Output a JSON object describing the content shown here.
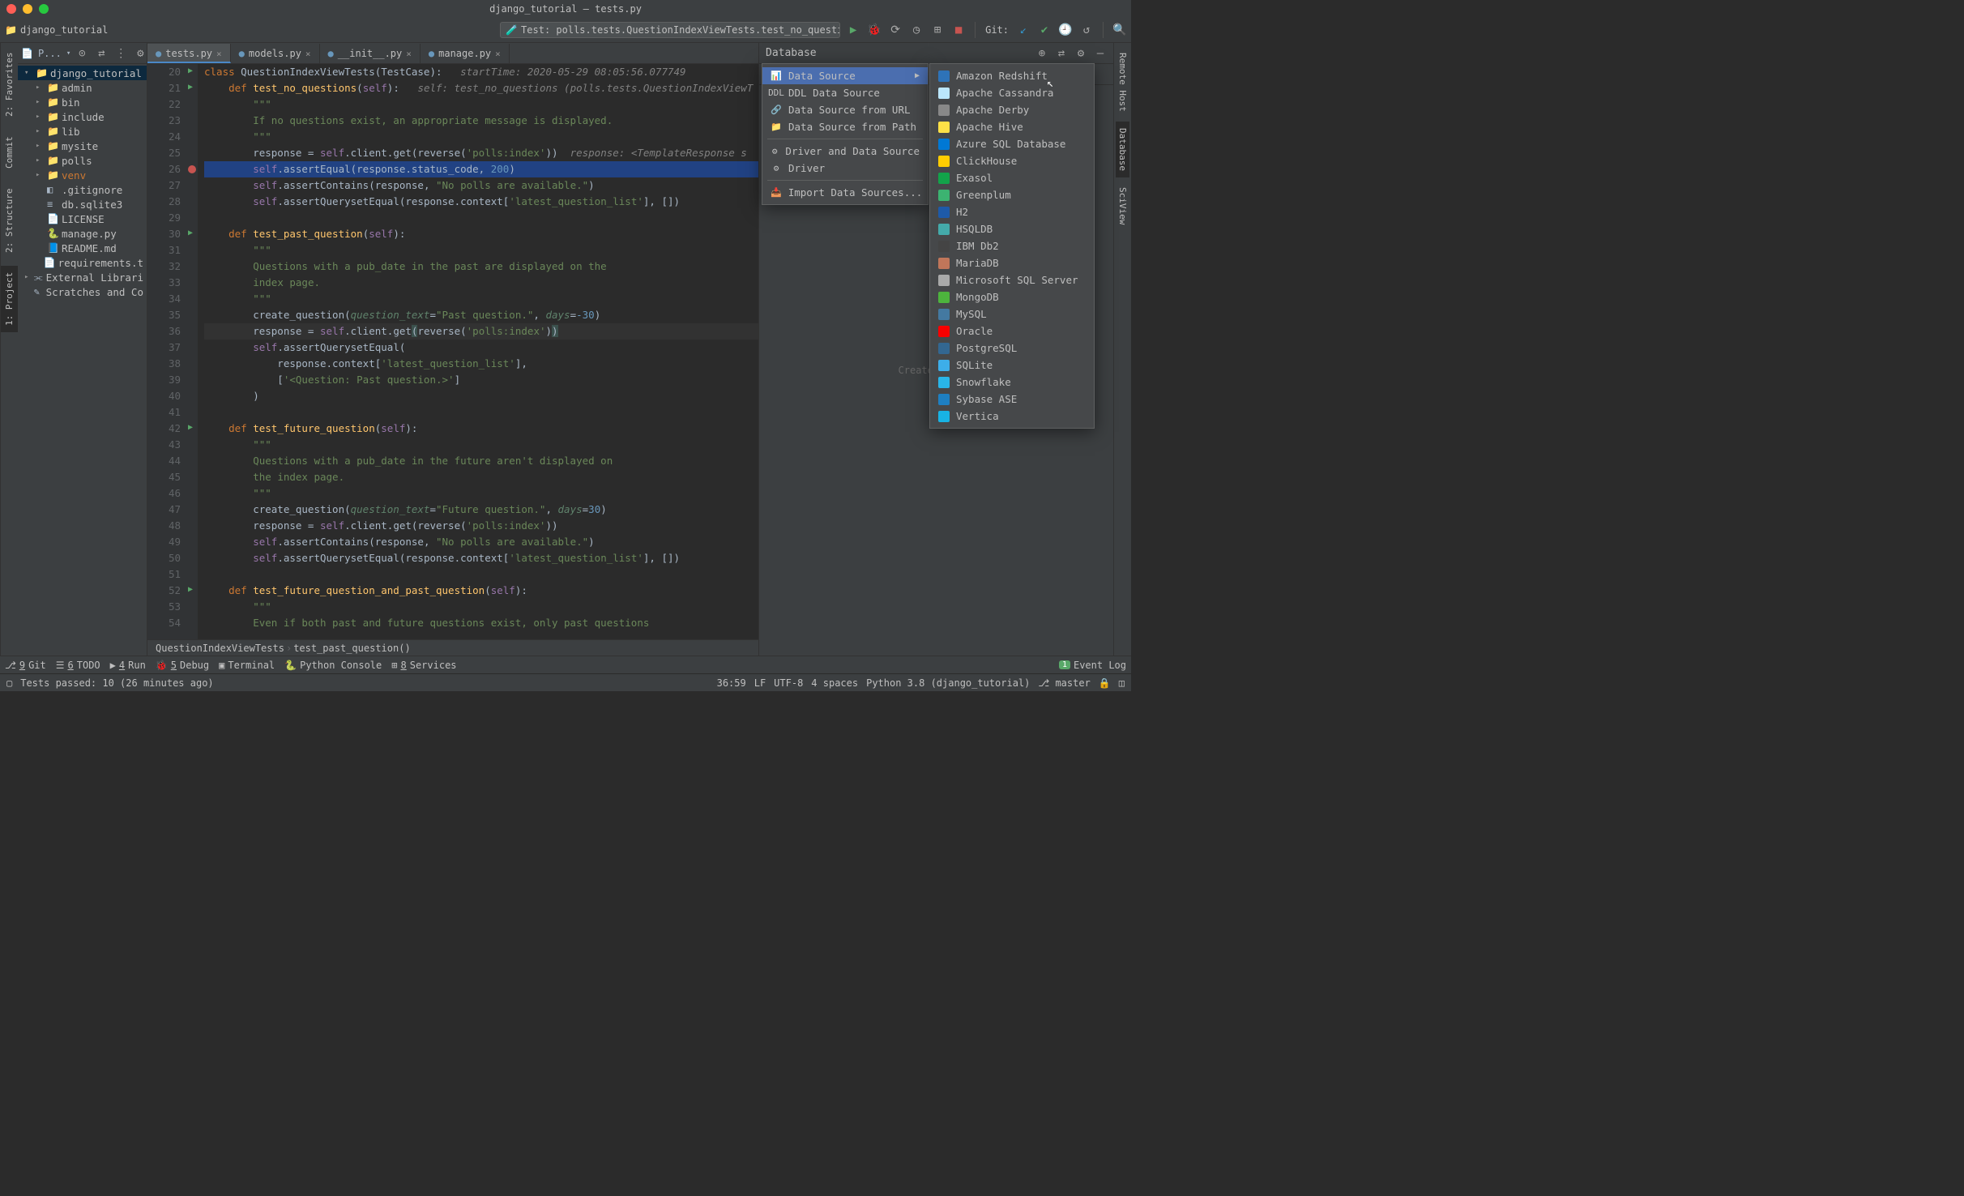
{
  "title": "django_tutorial – tests.py",
  "breadcrumb": "django_tutorial",
  "runConfig": "Test: polls.tests.QuestionIndexViewTests.test_no_questions",
  "gitLabel": "Git:",
  "leftTabs": [
    "1: Project",
    "2: Structure",
    "Commit",
    "2: Favorites"
  ],
  "rightTabs": [
    "Remote Host",
    "Database",
    "SciView"
  ],
  "sidebar": {
    "header": "P...",
    "tree": [
      {
        "lvl": 0,
        "arrow": "▾",
        "ico": "📁",
        "name": "django_tutorial",
        "root": true
      },
      {
        "lvl": 1,
        "arrow": "▸",
        "ico": "📁",
        "name": "admin"
      },
      {
        "lvl": 1,
        "arrow": "▸",
        "ico": "📁",
        "name": "bin"
      },
      {
        "lvl": 1,
        "arrow": "▸",
        "ico": "📁",
        "name": "include"
      },
      {
        "lvl": 1,
        "arrow": "▸",
        "ico": "📁",
        "name": "lib"
      },
      {
        "lvl": 1,
        "arrow": "▸",
        "ico": "📁",
        "name": "mysite"
      },
      {
        "lvl": 1,
        "arrow": "▸",
        "ico": "📁",
        "name": "polls"
      },
      {
        "lvl": 1,
        "arrow": "▸",
        "ico": "📁",
        "name": "venv",
        "venv": true
      },
      {
        "lvl": 1,
        "arrow": "",
        "ico": "◧",
        "name": ".gitignore"
      },
      {
        "lvl": 1,
        "arrow": "",
        "ico": "≡",
        "name": "db.sqlite3"
      },
      {
        "lvl": 1,
        "arrow": "",
        "ico": "📄",
        "name": "LICENSE"
      },
      {
        "lvl": 1,
        "arrow": "",
        "ico": "🐍",
        "name": "manage.py"
      },
      {
        "lvl": 1,
        "arrow": "",
        "ico": "📘",
        "name": "README.md"
      },
      {
        "lvl": 1,
        "arrow": "",
        "ico": "📄",
        "name": "requirements.t"
      },
      {
        "lvl": 0,
        "arrow": "▸",
        "ico": "⫘",
        "name": "External Librari"
      },
      {
        "lvl": 0,
        "arrow": "",
        "ico": "✎",
        "name": "Scratches and Co"
      }
    ]
  },
  "editorTabs": [
    {
      "label": "tests.py",
      "active": true
    },
    {
      "label": "models.py"
    },
    {
      "label": "__init__.py"
    },
    {
      "label": "manage.py"
    }
  ],
  "codeLines": [
    {
      "n": 20,
      "mark": "run",
      "html": "<span class='k'>class </span><span class='p'>QuestionIndexViewTests(TestCase):   </span><span class='c'>startTime: 2020-05-29 08:05:56.077749</span>"
    },
    {
      "n": 21,
      "mark": "run",
      "html": "    <span class='k'>def </span><span class='fn'>test_no_questions</span>(<span class='self'>self</span>):   <span class='c'>self: test_no_questions (polls.tests.QuestionIndexViewT</span>"
    },
    {
      "n": 22,
      "html": "        <span class='s'>\"\"\"</span>"
    },
    {
      "n": 23,
      "html": "        <span class='s'>If no questions exist, an appropriate message is displayed.</span>"
    },
    {
      "n": 24,
      "html": "        <span class='s'>\"\"\"</span>"
    },
    {
      "n": 25,
      "html": "        response = <span class='self'>self</span>.client.get(reverse(<span class='s'>'polls:index'</span>))  <span class='c'>response: &lt;TemplateResponse s</span>"
    },
    {
      "n": 26,
      "mark": "bp",
      "hl": true,
      "html": "        <span class='self'>self</span>.assertEqual(response.status_code, <span class='num'>200</span>)"
    },
    {
      "n": 27,
      "html": "        <span class='self'>self</span>.assertContains(response, <span class='s'>\"No polls are available.\"</span>)"
    },
    {
      "n": 28,
      "html": "        <span class='self'>self</span>.assertQuerysetEqual(response.context[<span class='s'>'latest_question_list'</span>], [])"
    },
    {
      "n": 29,
      "html": ""
    },
    {
      "n": 30,
      "mark": "run",
      "html": "    <span class='k'>def </span><span class='fn'>test_past_question</span>(<span class='self'>self</span>):"
    },
    {
      "n": 31,
      "html": "        <span class='s'>\"\"\"</span>"
    },
    {
      "n": 32,
      "html": "        <span class='s'>Questions with a pub_date in the past are displayed on the</span>"
    },
    {
      "n": 33,
      "html": "        <span class='s'>index page.</span>"
    },
    {
      "n": 34,
      "html": "        <span class='s'>\"\"\"</span>"
    },
    {
      "n": 35,
      "html": "        create_question(<span class='hint'>question_text</span>=<span class='s'>\"Past question.\"</span>, <span class='hint'>days</span>=<span class='num'>-30</span>)"
    },
    {
      "n": 36,
      "caret": true,
      "html": "        response = <span class='self'>self</span>.client.get<span style='background:#3b514d'>(</span>reverse(<span class='s'>'polls:index'</span>)<span style='background:#3b514d'>)</span>"
    },
    {
      "n": 37,
      "html": "        <span class='self'>self</span>.assertQuerysetEqual("
    },
    {
      "n": 38,
      "html": "            response.context[<span class='s'>'latest_question_list'</span>],"
    },
    {
      "n": 39,
      "html": "            [<span class='s'>'&lt;Question: Past question.&gt;'</span>]"
    },
    {
      "n": 40,
      "html": "        )"
    },
    {
      "n": 41,
      "html": ""
    },
    {
      "n": 42,
      "mark": "run",
      "html": "    <span class='k'>def </span><span class='fn'>test_future_question</span>(<span class='self'>self</span>):"
    },
    {
      "n": 43,
      "html": "        <span class='s'>\"\"\"</span>"
    },
    {
      "n": 44,
      "html": "        <span class='s'>Questions with a pub_date in the future aren't displayed on</span>"
    },
    {
      "n": 45,
      "html": "        <span class='s'>the index page.</span>"
    },
    {
      "n": 46,
      "html": "        <span class='s'>\"\"\"</span>"
    },
    {
      "n": 47,
      "html": "        create_question(<span class='hint'>question_text</span>=<span class='s'>\"Future question.\"</span>, <span class='hint'>days</span>=<span class='num'>30</span>)"
    },
    {
      "n": 48,
      "html": "        response = <span class='self'>self</span>.client.get(reverse(<span class='s'>'polls:index'</span>))"
    },
    {
      "n": 49,
      "html": "        <span class='self'>self</span>.assertContains(response, <span class='s'>\"No polls are available.\"</span>)"
    },
    {
      "n": 50,
      "html": "        <span class='self'>self</span>.assertQuerysetEqual(response.context[<span class='s'>'latest_question_list'</span>], [])"
    },
    {
      "n": 51,
      "html": ""
    },
    {
      "n": 52,
      "mark": "run",
      "html": "    <span class='k'>def </span><span class='fn'>test_future_question_and_past_question</span>(<span class='self'>self</span>):"
    },
    {
      "n": 53,
      "html": "        <span class='s'>\"\"\"</span>"
    },
    {
      "n": 54,
      "html": "        <span class='s'>Even if both past and future questions exist, only past questions</span>"
    }
  ],
  "editorCrumbs": [
    "QuestionIndexViewTests",
    "test_past_question()"
  ],
  "dbPanel": {
    "title": "Database",
    "hint": "Create a data"
  },
  "popupPrimary": [
    {
      "label": "Data Source",
      "hl": true,
      "sub": true,
      "ico": "📊"
    },
    {
      "label": "DDL Data Source",
      "ico": "DDL"
    },
    {
      "label": "Data Source from URL",
      "ico": "🔗"
    },
    {
      "label": "Data Source from Path",
      "ico": "📁"
    },
    {
      "sep": true
    },
    {
      "label": "Driver and Data Source",
      "ico": "⚙"
    },
    {
      "label": "Driver",
      "ico": "⚙"
    },
    {
      "sep": true
    },
    {
      "label": "Import Data Sources...",
      "ico": "📥"
    }
  ],
  "popupSub": [
    {
      "label": "Amazon Redshift",
      "c": "#2e73b8"
    },
    {
      "label": "Apache Cassandra",
      "c": "#bbe6fb"
    },
    {
      "label": "Apache Derby",
      "c": "#888"
    },
    {
      "label": "Apache Hive",
      "c": "#fde047"
    },
    {
      "label": "Azure SQL Database",
      "c": "#0078d4"
    },
    {
      "label": "ClickHouse",
      "c": "#ffcc00"
    },
    {
      "label": "Exasol",
      "c": "#12a34a"
    },
    {
      "label": "Greenplum",
      "c": "#3cb371"
    },
    {
      "label": "H2",
      "c": "#1e5aa8"
    },
    {
      "label": "HSQLDB",
      "c": "#4aa"
    },
    {
      "label": "IBM Db2",
      "c": "#444"
    },
    {
      "label": "MariaDB",
      "c": "#c0765a"
    },
    {
      "label": "Microsoft SQL Server",
      "c": "#a9a9a9"
    },
    {
      "label": "MongoDB",
      "c": "#4db33d"
    },
    {
      "label": "MySQL",
      "c": "#4479a1"
    },
    {
      "label": "Oracle",
      "c": "#f80000"
    },
    {
      "label": "PostgreSQL",
      "c": "#336791"
    },
    {
      "label": "SQLite",
      "c": "#3daee9"
    },
    {
      "label": "Snowflake",
      "c": "#29b5e8"
    },
    {
      "label": "Sybase ASE",
      "c": "#1e7fc1"
    },
    {
      "label": "Vertica",
      "c": "#18b3e4"
    }
  ],
  "bottomTabs": [
    "9: Git",
    "6: TODO",
    "4: Run",
    "5: Debug",
    "Terminal",
    "Python Console",
    "8: Services"
  ],
  "eventLog": "Event Log",
  "statusLeft": "Tests passed: 10 (26 minutes ago)",
  "statusRight": [
    "36:59",
    "LF",
    "UTF-8",
    "4 spaces",
    "Python 3.8 (django_tutorial)",
    "master"
  ]
}
